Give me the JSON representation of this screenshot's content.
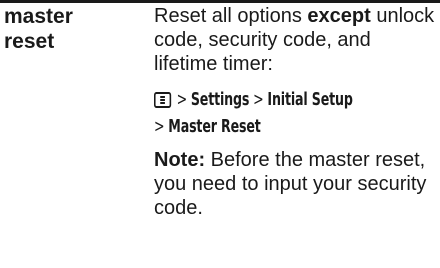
{
  "term": {
    "line1": "master",
    "line2": "reset"
  },
  "description": {
    "pre": "Reset all options ",
    "emphasis": "except",
    "post": " unlock code, security code, and lifetime timer:"
  },
  "menu_path": {
    "icon": "menu-key-icon",
    "sep1": " > ",
    "item1": "Settings",
    "sep2": " > ",
    "item2": "Initial Setup",
    "sep3": "> ",
    "item3": "Master Reset"
  },
  "note": {
    "label": "Note:",
    "text": " Before the master reset, you need to input your security code."
  }
}
